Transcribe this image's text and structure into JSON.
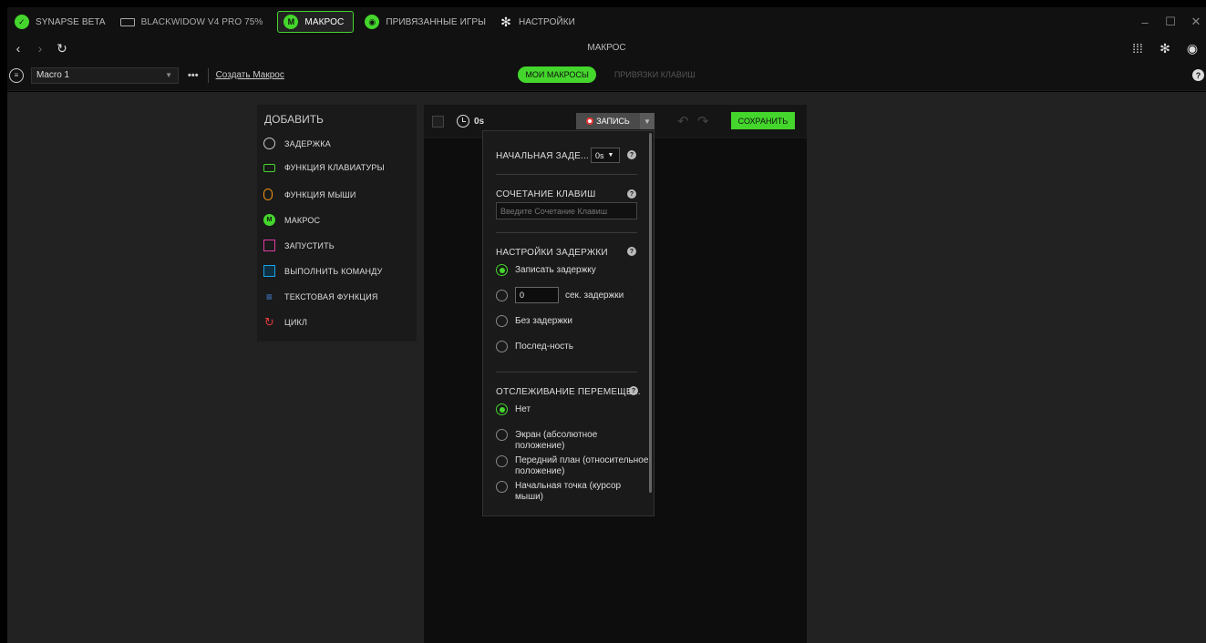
{
  "tabs": [
    {
      "label": "SYNAPSE BETA",
      "icon": "synapse-logo-icon"
    },
    {
      "label": "BLACKWIDOW V4 PRO 75%",
      "icon": "keyboard-icon"
    },
    {
      "label": "МАКРОС",
      "icon": "macro-icon",
      "active": true
    },
    {
      "label": "ПРИВЯЗАННЫЕ ИГРЫ",
      "icon": "gamepad-icon"
    },
    {
      "label": "НАСТРОЙКИ",
      "icon": "gear-icon"
    }
  ],
  "nav": {
    "title": "МАКРОС"
  },
  "profile": {
    "selected_macro": "Macro 1",
    "create_link": "Создать Макрос",
    "tab_my_macros": "МОИ МАКРОСЫ",
    "tab_keybinds": "ПРИВЯЗКИ КЛАВИШ"
  },
  "add_panel": {
    "title": "ДОБАВИТЬ",
    "items": [
      {
        "label": "ЗАДЕРЖКА",
        "icon": "clock-icon"
      },
      {
        "label": "ФУНКЦИЯ КЛАВИАТУРЫ",
        "icon": "keyboard-icon"
      },
      {
        "label": "ФУНКЦИЯ МЫШИ",
        "icon": "mouse-icon"
      },
      {
        "label": "МАКРОС",
        "icon": "macro-icon"
      },
      {
        "label": "ЗАПУСТИТЬ",
        "icon": "launch-icon"
      },
      {
        "label": "ВЫПОЛНИТЬ КОМАНДУ",
        "icon": "command-icon"
      },
      {
        "label": "ТЕКСТОВАЯ ФУНКЦИЯ",
        "icon": "text-icon"
      },
      {
        "label": "ЦИКЛ",
        "icon": "loop-icon"
      }
    ]
  },
  "editor": {
    "duration": "0s",
    "record_label": "ЗАПИСЬ",
    "save_label": "СОХРАНИТЬ"
  },
  "popup": {
    "initial_delay_label": "НАЧАЛЬНАЯ ЗАДЕ...",
    "initial_delay_value": "0s",
    "shortcut_label": "СОЧЕТАНИЕ КЛАВИШ",
    "shortcut_placeholder": "Введите Сочетание Клавиш",
    "delay_settings_label": "НАСТРОЙКИ ЗАДЕРЖКИ",
    "delay_options": {
      "record": "Записать задержку",
      "custom_value": "0",
      "custom_suffix": "сек. задержки",
      "none": "Без задержки",
      "sequence": "Послед-ность"
    },
    "delay_selected": "record",
    "tracking_label": "ОТСЛЕЖИВАНИЕ ПЕРЕМЕЩЕ...",
    "tracking_options": {
      "none": "Нет",
      "screen": "Экран (абсолютное положение)",
      "foreground": "Передний план (относительное положение)",
      "start_point": "Начальная точка (курсор мыши)"
    },
    "tracking_selected": "none"
  },
  "colors": {
    "accent": "#44d62c",
    "record": "#e83838"
  }
}
